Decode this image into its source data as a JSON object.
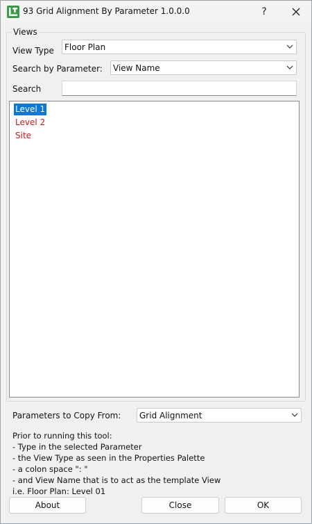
{
  "window": {
    "title": "93 Grid Alignment By Parameter 1.0.0.0",
    "help_label": "?"
  },
  "views": {
    "group_label": "Views",
    "view_type_label": "View Type",
    "view_type_value": "Floor Plan",
    "search_param_label": "Search by Parameter:",
    "search_param_value": "View Name",
    "search_label": "Search",
    "search_value": "",
    "items": [
      {
        "label": "Level 1",
        "selected": true
      },
      {
        "label": "Level 2",
        "selected": false
      },
      {
        "label": "Site",
        "selected": false
      }
    ]
  },
  "copy_from": {
    "label": "Parameters to Copy From:",
    "value": "Grid Alignment"
  },
  "notes": [
    "Prior to running this tool:",
    "- Type in the selected Parameter",
    "- the View Type as seen in the Properties Palette",
    "- a colon space \": \"",
    "- and View Name that is to act as the template View",
    "i.e. Floor Plan: Level 01"
  ],
  "buttons": {
    "about": "About",
    "close": "Close",
    "ok": "OK"
  },
  "colors": {
    "accent": "#0a78d7",
    "item_text": "#cc1818",
    "app_icon": "#3a9a47"
  }
}
